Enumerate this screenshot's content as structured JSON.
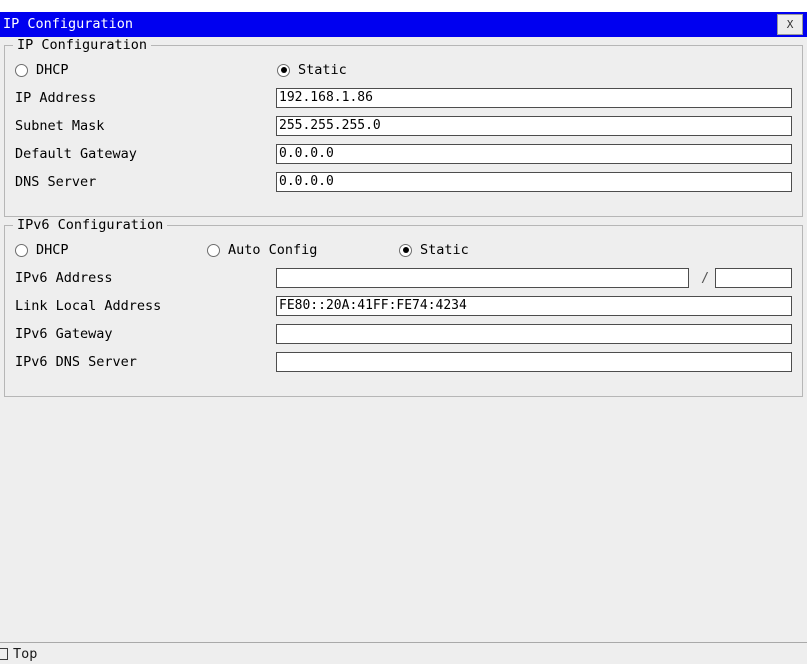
{
  "window": {
    "title": "IP Configuration",
    "close_label": "X",
    "close_icon": "close-icon"
  },
  "ipv4": {
    "group_title": "IP Configuration",
    "mode": {
      "dhcp_label": "DHCP",
      "dhcp_selected": false,
      "static_label": "Static",
      "static_selected": true
    },
    "fields": [
      {
        "label": "IP Address",
        "value": "192.168.1.86",
        "placeholder": ""
      },
      {
        "label": "Subnet Mask",
        "value": "255.255.255.0",
        "placeholder": ""
      },
      {
        "label": "Default Gateway",
        "value": "0.0.0.0",
        "placeholder": ""
      },
      {
        "label": "DNS Server",
        "value": "0.0.0.0",
        "placeholder": ""
      }
    ]
  },
  "ipv6": {
    "group_title": "IPv6 Configuration",
    "mode": {
      "dhcp_label": "DHCP",
      "dhcp_selected": false,
      "auto_config_label": "Auto Config",
      "auto_config_selected": false,
      "static_label": "Static",
      "static_selected": true
    },
    "address_row": {
      "label": "IPv6 Address",
      "value": "",
      "separator": "/",
      "prefix_value": ""
    },
    "fields": [
      {
        "label": "Link Local Address",
        "value": "FE80::20A:41FF:FE74:4234",
        "placeholder": ""
      },
      {
        "label": "IPv6 Gateway",
        "value": "",
        "placeholder": ""
      },
      {
        "label": "IPv6 DNS Server",
        "value": "",
        "placeholder": ""
      }
    ]
  },
  "statusbar": {
    "icon": "square-icon",
    "text": "Top"
  },
  "colors": {
    "titlebar": "#0000f0",
    "titlebar_text": "#ffffff",
    "client_bg": "#eeeeee",
    "field_bg": "#ffffff",
    "field_border": "#4d4d4d",
    "group_border": "#b6b6b6"
  }
}
